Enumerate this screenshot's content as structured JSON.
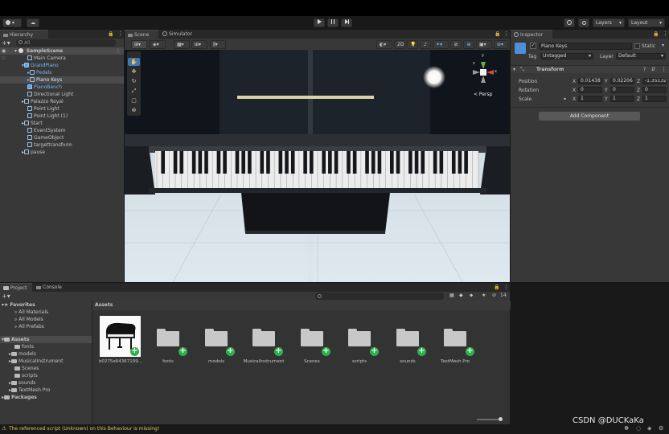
{
  "toolbar": {
    "account_label": "▾",
    "cloud_label": "☁",
    "layers_label": "Layers",
    "layout_label": "Layout"
  },
  "hierarchy": {
    "tab_label": "Hierarchy",
    "search_placeholder": "All",
    "scene_name": "SampleScene",
    "items": [
      {
        "label": "Main Camera"
      },
      {
        "label": "GrandPiano"
      },
      {
        "label": "Pedals"
      },
      {
        "label": "Piano Keys"
      },
      {
        "label": "PianoBench"
      },
      {
        "label": "Directional Light"
      },
      {
        "label": "Palazzo Royal"
      },
      {
        "label": "Point Light"
      },
      {
        "label": "Point Light (1)"
      },
      {
        "label": "Start"
      },
      {
        "label": "EventSystem"
      },
      {
        "label": "GameObject"
      },
      {
        "label": "targettransform"
      },
      {
        "label": "pause"
      }
    ]
  },
  "scene": {
    "tab_scene": "Scene",
    "tab_simulator": "Simulator",
    "mode_2d": "2D",
    "persp_label": "< Persp",
    "axis_y": "y",
    "axis_z": "z",
    "axis_x": "x"
  },
  "inspector": {
    "tab_label": "Inspector",
    "object_name": "Piano Keys",
    "static_label": "Static",
    "tag_label": "Tag",
    "tag_value": "Untagged",
    "layer_label": "Layer",
    "layer_value": "Default",
    "component_title": "Transform",
    "position_label": "Position",
    "rotation_label": "Rotation",
    "scale_label": "Scale",
    "position": {
      "x": "0.01438",
      "y": "0.02206",
      "z": "-1.35132"
    },
    "rotation": {
      "x": "0",
      "y": "0",
      "z": "0"
    },
    "scale": {
      "x": "1",
      "y": "1",
      "z": "1"
    },
    "add_component": "Add Component"
  },
  "project": {
    "tab_project": "Project",
    "tab_console": "Console",
    "count": "14",
    "favorites_label": "Favorites",
    "favorites": [
      "All Materials",
      "All Models",
      "All Prefabs"
    ],
    "assets_label": "Assets",
    "asset_folders": [
      "fonts",
      "models",
      "MusicalInstrument",
      "Scenes",
      "scripts",
      "sounds",
      "TextMesh Pro"
    ],
    "packages_label": "Packages",
    "breadcrumb": "Assets",
    "grid_items": [
      {
        "label": "b0275e64367199..."
      },
      {
        "label": "fonts"
      },
      {
        "label": "models"
      },
      {
        "label": "MusicalInstrument"
      },
      {
        "label": "Scenes"
      },
      {
        "label": "scripts"
      },
      {
        "label": "sounds"
      },
      {
        "label": "TextMesh Pro"
      }
    ]
  },
  "status": {
    "message": "The referenced script (Unknown) on this Behaviour is missing!",
    "color": "#e8c36a"
  },
  "watermark": "CSDN @DUCKaKa"
}
